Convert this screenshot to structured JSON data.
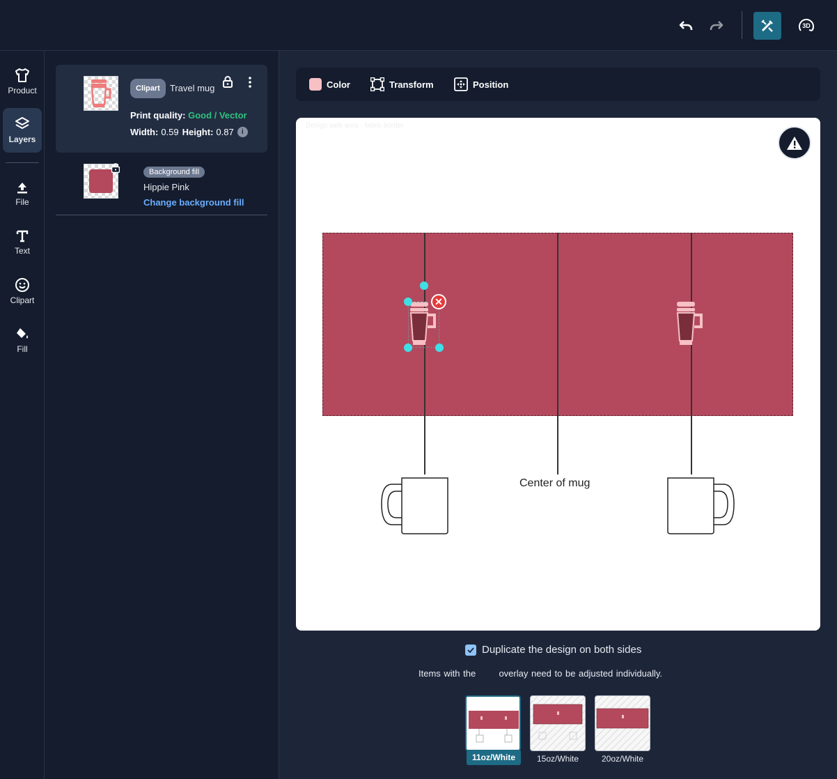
{
  "topbar": {
    "undo_icon": "undo-icon",
    "redo_icon": "redo-icon",
    "edit_icon": "edit-design-icon",
    "view3d_label": "3D"
  },
  "rail": {
    "items": [
      {
        "label": "Product",
        "icon": "tshirt-icon"
      },
      {
        "label": "Layers",
        "icon": "layers-icon",
        "active": true
      },
      {
        "label": "File",
        "icon": "upload-icon"
      },
      {
        "label": "Text",
        "icon": "text-icon"
      },
      {
        "label": "Clipart",
        "icon": "smiley-icon"
      },
      {
        "label": "Fill",
        "icon": "paint-bucket-icon"
      }
    ]
  },
  "layers": {
    "clipart": {
      "type_label": "Clipart",
      "name": "Travel mug",
      "print_quality_label": "Print quality:",
      "print_quality_value": "Good / Vector",
      "width_label": "Width:",
      "width_value": "0.59",
      "height_label": "Height:",
      "height_value": "0.87"
    },
    "background": {
      "type_label": "Background fill",
      "name": "Hippie Pink",
      "action": "Change background fill",
      "color": "#b4495d"
    }
  },
  "toolbar": {
    "color_label": "Color",
    "transform_label": "Transform",
    "position_label": "Position",
    "color_swatch": "#f6c0c4"
  },
  "canvas": {
    "faint_text": "Design safe area - fabric border",
    "center_label": "Center of mug",
    "print_color": "#b4495d",
    "clipart_color": "#f6c0c4"
  },
  "options": {
    "duplicate_label": "Duplicate the design on both sides",
    "duplicate_checked": true,
    "note_before": "Items with the",
    "note_after": "overlay need to be adjusted individually."
  },
  "sizes": [
    {
      "label": "11oz/White",
      "selected": true
    },
    {
      "label": "15oz/White",
      "selected": false
    },
    {
      "label": "20oz/White",
      "selected": false
    }
  ]
}
